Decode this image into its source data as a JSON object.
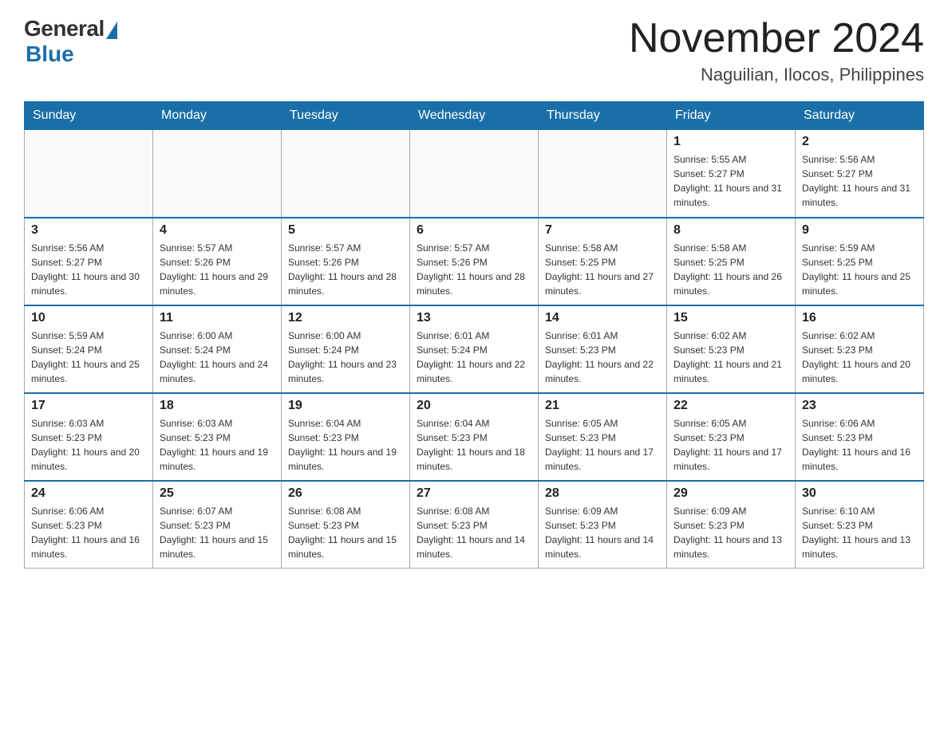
{
  "header": {
    "logo_general": "General",
    "logo_blue": "Blue",
    "month_title": "November 2024",
    "location": "Naguilian, Ilocos, Philippines"
  },
  "weekdays": [
    "Sunday",
    "Monday",
    "Tuesday",
    "Wednesday",
    "Thursday",
    "Friday",
    "Saturday"
  ],
  "weeks": [
    [
      {
        "day": "",
        "sunrise": "",
        "sunset": "",
        "daylight": ""
      },
      {
        "day": "",
        "sunrise": "",
        "sunset": "",
        "daylight": ""
      },
      {
        "day": "",
        "sunrise": "",
        "sunset": "",
        "daylight": ""
      },
      {
        "day": "",
        "sunrise": "",
        "sunset": "",
        "daylight": ""
      },
      {
        "day": "",
        "sunrise": "",
        "sunset": "",
        "daylight": ""
      },
      {
        "day": "1",
        "sunrise": "Sunrise: 5:55 AM",
        "sunset": "Sunset: 5:27 PM",
        "daylight": "Daylight: 11 hours and 31 minutes."
      },
      {
        "day": "2",
        "sunrise": "Sunrise: 5:56 AM",
        "sunset": "Sunset: 5:27 PM",
        "daylight": "Daylight: 11 hours and 31 minutes."
      }
    ],
    [
      {
        "day": "3",
        "sunrise": "Sunrise: 5:56 AM",
        "sunset": "Sunset: 5:27 PM",
        "daylight": "Daylight: 11 hours and 30 minutes."
      },
      {
        "day": "4",
        "sunrise": "Sunrise: 5:57 AM",
        "sunset": "Sunset: 5:26 PM",
        "daylight": "Daylight: 11 hours and 29 minutes."
      },
      {
        "day": "5",
        "sunrise": "Sunrise: 5:57 AM",
        "sunset": "Sunset: 5:26 PM",
        "daylight": "Daylight: 11 hours and 28 minutes."
      },
      {
        "day": "6",
        "sunrise": "Sunrise: 5:57 AM",
        "sunset": "Sunset: 5:26 PM",
        "daylight": "Daylight: 11 hours and 28 minutes."
      },
      {
        "day": "7",
        "sunrise": "Sunrise: 5:58 AM",
        "sunset": "Sunset: 5:25 PM",
        "daylight": "Daylight: 11 hours and 27 minutes."
      },
      {
        "day": "8",
        "sunrise": "Sunrise: 5:58 AM",
        "sunset": "Sunset: 5:25 PM",
        "daylight": "Daylight: 11 hours and 26 minutes."
      },
      {
        "day": "9",
        "sunrise": "Sunrise: 5:59 AM",
        "sunset": "Sunset: 5:25 PM",
        "daylight": "Daylight: 11 hours and 25 minutes."
      }
    ],
    [
      {
        "day": "10",
        "sunrise": "Sunrise: 5:59 AM",
        "sunset": "Sunset: 5:24 PM",
        "daylight": "Daylight: 11 hours and 25 minutes."
      },
      {
        "day": "11",
        "sunrise": "Sunrise: 6:00 AM",
        "sunset": "Sunset: 5:24 PM",
        "daylight": "Daylight: 11 hours and 24 minutes."
      },
      {
        "day": "12",
        "sunrise": "Sunrise: 6:00 AM",
        "sunset": "Sunset: 5:24 PM",
        "daylight": "Daylight: 11 hours and 23 minutes."
      },
      {
        "day": "13",
        "sunrise": "Sunrise: 6:01 AM",
        "sunset": "Sunset: 5:24 PM",
        "daylight": "Daylight: 11 hours and 22 minutes."
      },
      {
        "day": "14",
        "sunrise": "Sunrise: 6:01 AM",
        "sunset": "Sunset: 5:23 PM",
        "daylight": "Daylight: 11 hours and 22 minutes."
      },
      {
        "day": "15",
        "sunrise": "Sunrise: 6:02 AM",
        "sunset": "Sunset: 5:23 PM",
        "daylight": "Daylight: 11 hours and 21 minutes."
      },
      {
        "day": "16",
        "sunrise": "Sunrise: 6:02 AM",
        "sunset": "Sunset: 5:23 PM",
        "daylight": "Daylight: 11 hours and 20 minutes."
      }
    ],
    [
      {
        "day": "17",
        "sunrise": "Sunrise: 6:03 AM",
        "sunset": "Sunset: 5:23 PM",
        "daylight": "Daylight: 11 hours and 20 minutes."
      },
      {
        "day": "18",
        "sunrise": "Sunrise: 6:03 AM",
        "sunset": "Sunset: 5:23 PM",
        "daylight": "Daylight: 11 hours and 19 minutes."
      },
      {
        "day": "19",
        "sunrise": "Sunrise: 6:04 AM",
        "sunset": "Sunset: 5:23 PM",
        "daylight": "Daylight: 11 hours and 19 minutes."
      },
      {
        "day": "20",
        "sunrise": "Sunrise: 6:04 AM",
        "sunset": "Sunset: 5:23 PM",
        "daylight": "Daylight: 11 hours and 18 minutes."
      },
      {
        "day": "21",
        "sunrise": "Sunrise: 6:05 AM",
        "sunset": "Sunset: 5:23 PM",
        "daylight": "Daylight: 11 hours and 17 minutes."
      },
      {
        "day": "22",
        "sunrise": "Sunrise: 6:05 AM",
        "sunset": "Sunset: 5:23 PM",
        "daylight": "Daylight: 11 hours and 17 minutes."
      },
      {
        "day": "23",
        "sunrise": "Sunrise: 6:06 AM",
        "sunset": "Sunset: 5:23 PM",
        "daylight": "Daylight: 11 hours and 16 minutes."
      }
    ],
    [
      {
        "day": "24",
        "sunrise": "Sunrise: 6:06 AM",
        "sunset": "Sunset: 5:23 PM",
        "daylight": "Daylight: 11 hours and 16 minutes."
      },
      {
        "day": "25",
        "sunrise": "Sunrise: 6:07 AM",
        "sunset": "Sunset: 5:23 PM",
        "daylight": "Daylight: 11 hours and 15 minutes."
      },
      {
        "day": "26",
        "sunrise": "Sunrise: 6:08 AM",
        "sunset": "Sunset: 5:23 PM",
        "daylight": "Daylight: 11 hours and 15 minutes."
      },
      {
        "day": "27",
        "sunrise": "Sunrise: 6:08 AM",
        "sunset": "Sunset: 5:23 PM",
        "daylight": "Daylight: 11 hours and 14 minutes."
      },
      {
        "day": "28",
        "sunrise": "Sunrise: 6:09 AM",
        "sunset": "Sunset: 5:23 PM",
        "daylight": "Daylight: 11 hours and 14 minutes."
      },
      {
        "day": "29",
        "sunrise": "Sunrise: 6:09 AM",
        "sunset": "Sunset: 5:23 PM",
        "daylight": "Daylight: 11 hours and 13 minutes."
      },
      {
        "day": "30",
        "sunrise": "Sunrise: 6:10 AM",
        "sunset": "Sunset: 5:23 PM",
        "daylight": "Daylight: 11 hours and 13 minutes."
      }
    ]
  ]
}
